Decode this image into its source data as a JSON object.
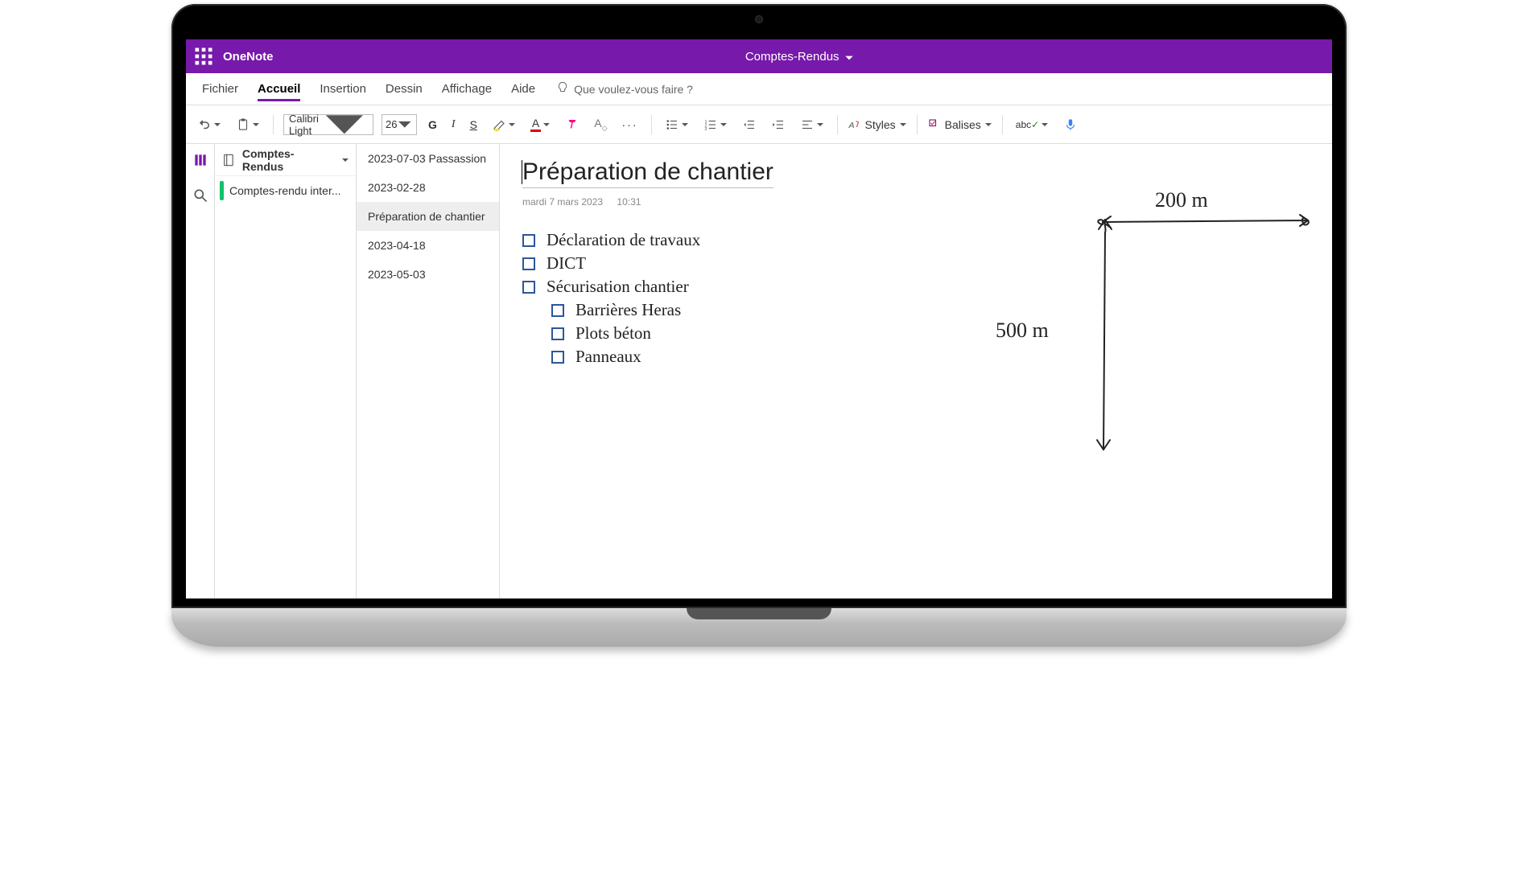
{
  "app": {
    "name": "OneNote",
    "notebook_dropdown": "Comptes-Rendus"
  },
  "menu": {
    "items": [
      "Fichier",
      "Accueil",
      "Insertion",
      "Dessin",
      "Affichage",
      "Aide"
    ],
    "active_index": 1,
    "tellme_placeholder": "Que voulez-vous faire ?"
  },
  "ribbon": {
    "font_name": "Calibri Light",
    "font_size": "26",
    "styles_label": "Styles",
    "tags_label": "Balises"
  },
  "nav": {
    "notebook": "Comptes-Rendus",
    "section": "Comptes-rendu inter...",
    "pages": [
      "2023-07-03 Passassion",
      "2023-02-28",
      "Préparation de chantier",
      "2023-04-18",
      "2023-05-03"
    ],
    "selected_page_index": 2
  },
  "page": {
    "title": "Préparation de chantier",
    "date": "mardi 7 mars 2023",
    "time": "10:31",
    "checklist": [
      {
        "text": "Déclaration de travaux",
        "indent": 0
      },
      {
        "text": "DICT",
        "indent": 0
      },
      {
        "text": "Sécurisation chantier",
        "indent": 0
      },
      {
        "text": "Barrières Heras",
        "indent": 1
      },
      {
        "text": "Plots béton",
        "indent": 1
      },
      {
        "text": "Panneaux",
        "indent": 1
      }
    ],
    "ink_labels": {
      "horizontal": "200 m",
      "vertical": "500 m"
    }
  }
}
